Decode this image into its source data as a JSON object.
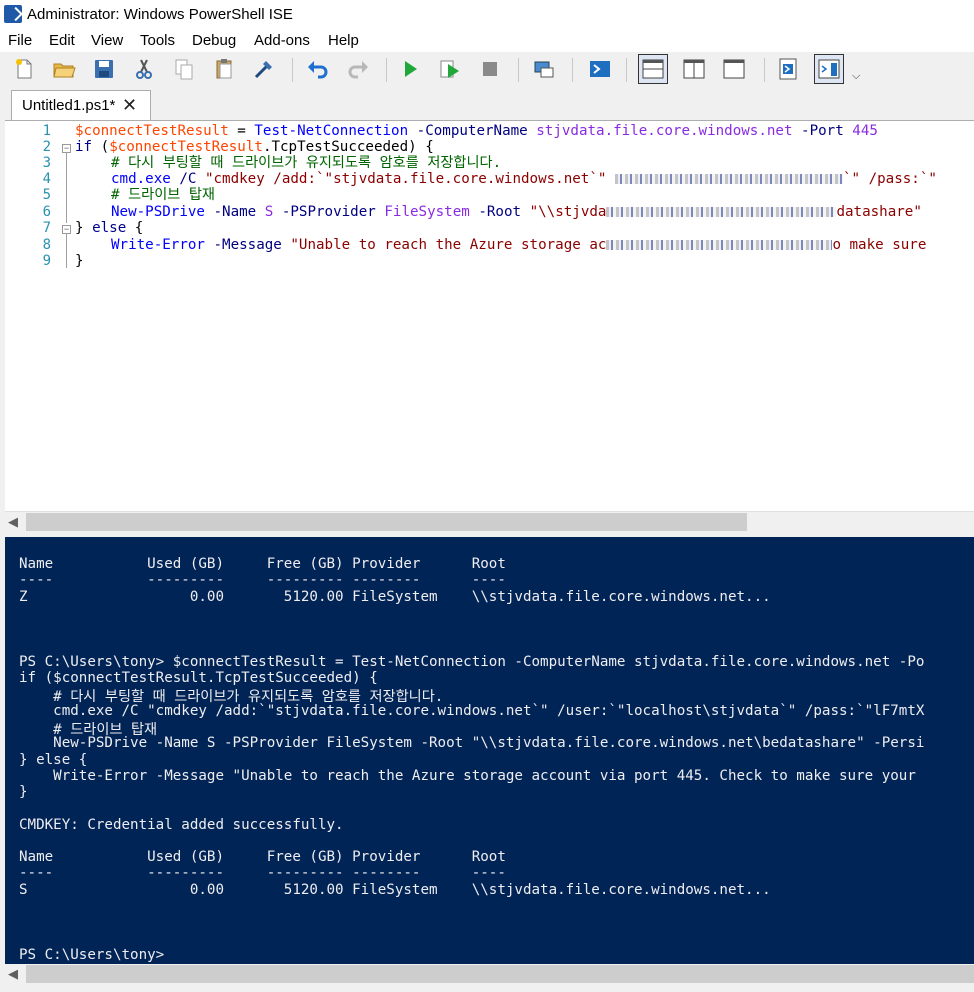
{
  "window": {
    "title": "Administrator: Windows PowerShell ISE"
  },
  "menu": [
    "File",
    "Edit",
    "View",
    "Tools",
    "Debug",
    "Add-ons",
    "Help"
  ],
  "toolbar": {
    "icons": [
      "new-file-icon",
      "open-folder-icon",
      "save-icon",
      "cut-icon",
      "copy-icon",
      "paste-icon",
      "clear-console-icon",
      "undo-icon",
      "redo-icon",
      "run-script-icon",
      "run-selection-icon",
      "stop-icon",
      "new-remote-tab-icon",
      "start-powershell-icon",
      "show-script-pane-top-icon",
      "show-script-pane-right-icon",
      "show-script-pane-maximized-icon",
      "show-command-window-icon",
      "show-command-addon-icon"
    ]
  },
  "tab": {
    "label": "Untitled1.ps1*",
    "close": "✕"
  },
  "editor": {
    "line_numbers": [
      "1",
      "2",
      "3",
      "4",
      "5",
      "6",
      "7",
      "8",
      "9"
    ],
    "l1_var": "$connectTestResult",
    "l1_eq": " = ",
    "l1_cmd": "Test-NetConnection",
    "l1_p1": " -ComputerName ",
    "l1_host": "stjvdata.file.core.windows.net",
    "l1_p2": " -Port ",
    "l1_port": "445",
    "l2_if": "if",
    "l2_open": " (",
    "l2_var": "$connectTestResult",
    "l2_prop": ".TcpTestSucceeded",
    "l2_close": ") {",
    "l3_comment": "# 다시 부팅할 때 드라이브가 유지되도록 암호를 저장합니다.",
    "l4_cmd": "cmd.exe",
    "l4_arg": " /C",
    "l4_str_a": " \"cmdkey /add:`\"stjvdata.file.core.windows.net`\"",
    "l4_str_b": "`\" /pass:`\"",
    "l5_comment": "# 드라이브 탑재",
    "l6_cmd": "New-PSDrive",
    "l6_p1": " -Name ",
    "l6_name": "S",
    "l6_p2": " -PSProvider ",
    "l6_prov": "FileSystem",
    "l6_p3": " -Root ",
    "l6_str_a": "\"\\\\stjvda",
    "l6_str_b": "datashare\"",
    "l7_brace": "} ",
    "l7_else": "else",
    "l7_open": " {",
    "l8_cmd": "Write-Error",
    "l8_p1": " -Message ",
    "l8_str_a": "\"Unable to reach the Azure storage ac",
    "l8_str_b": "o make sure",
    "l9_brace": "}"
  },
  "console": {
    "lines": [
      "Name           Used (GB)     Free (GB) Provider      Root",
      "----           ---------     --------- --------      ----",
      "Z                   0.00       5120.00 FileSystem    \\\\stjvdata.file.core.windows.net...",
      "PS C:\\Users\\tony> $connectTestResult = Test-NetConnection -ComputerName stjvdata.file.core.windows.net -Po",
      "if ($connectTestResult.TcpTestSucceeded) {",
      "    # 다시 부팅할 때 드라이브가 유지되도록 암호를 저장합니다.",
      "    cmd.exe /C \"cmdkey /add:`\"stjvdata.file.core.windows.net`\" /user:`\"localhost\\stjvdata`\" /pass:`\"lF7mtX",
      "    # 드라이브 탑재",
      "    New-PSDrive -Name S -PSProvider FileSystem -Root \"\\\\stjvdata.file.core.windows.net\\bedatashare\" -Persi",
      "} else {",
      "    Write-Error -Message \"Unable to reach the Azure storage account via port 445. Check to make sure your",
      "}",
      "CMDKEY: Credential added successfully.",
      "Name           Used (GB)     Free (GB) Provider      Root",
      "----           ---------     --------- --------      ----",
      "S                   0.00       5120.00 FileSystem    \\\\stjvdata.file.core.windows.net...",
      "PS C:\\Users\\tony>"
    ]
  },
  "colors": {
    "console_bg": "#012456",
    "console_fg": "#eeedf0",
    "line_number": "#2b91af"
  }
}
